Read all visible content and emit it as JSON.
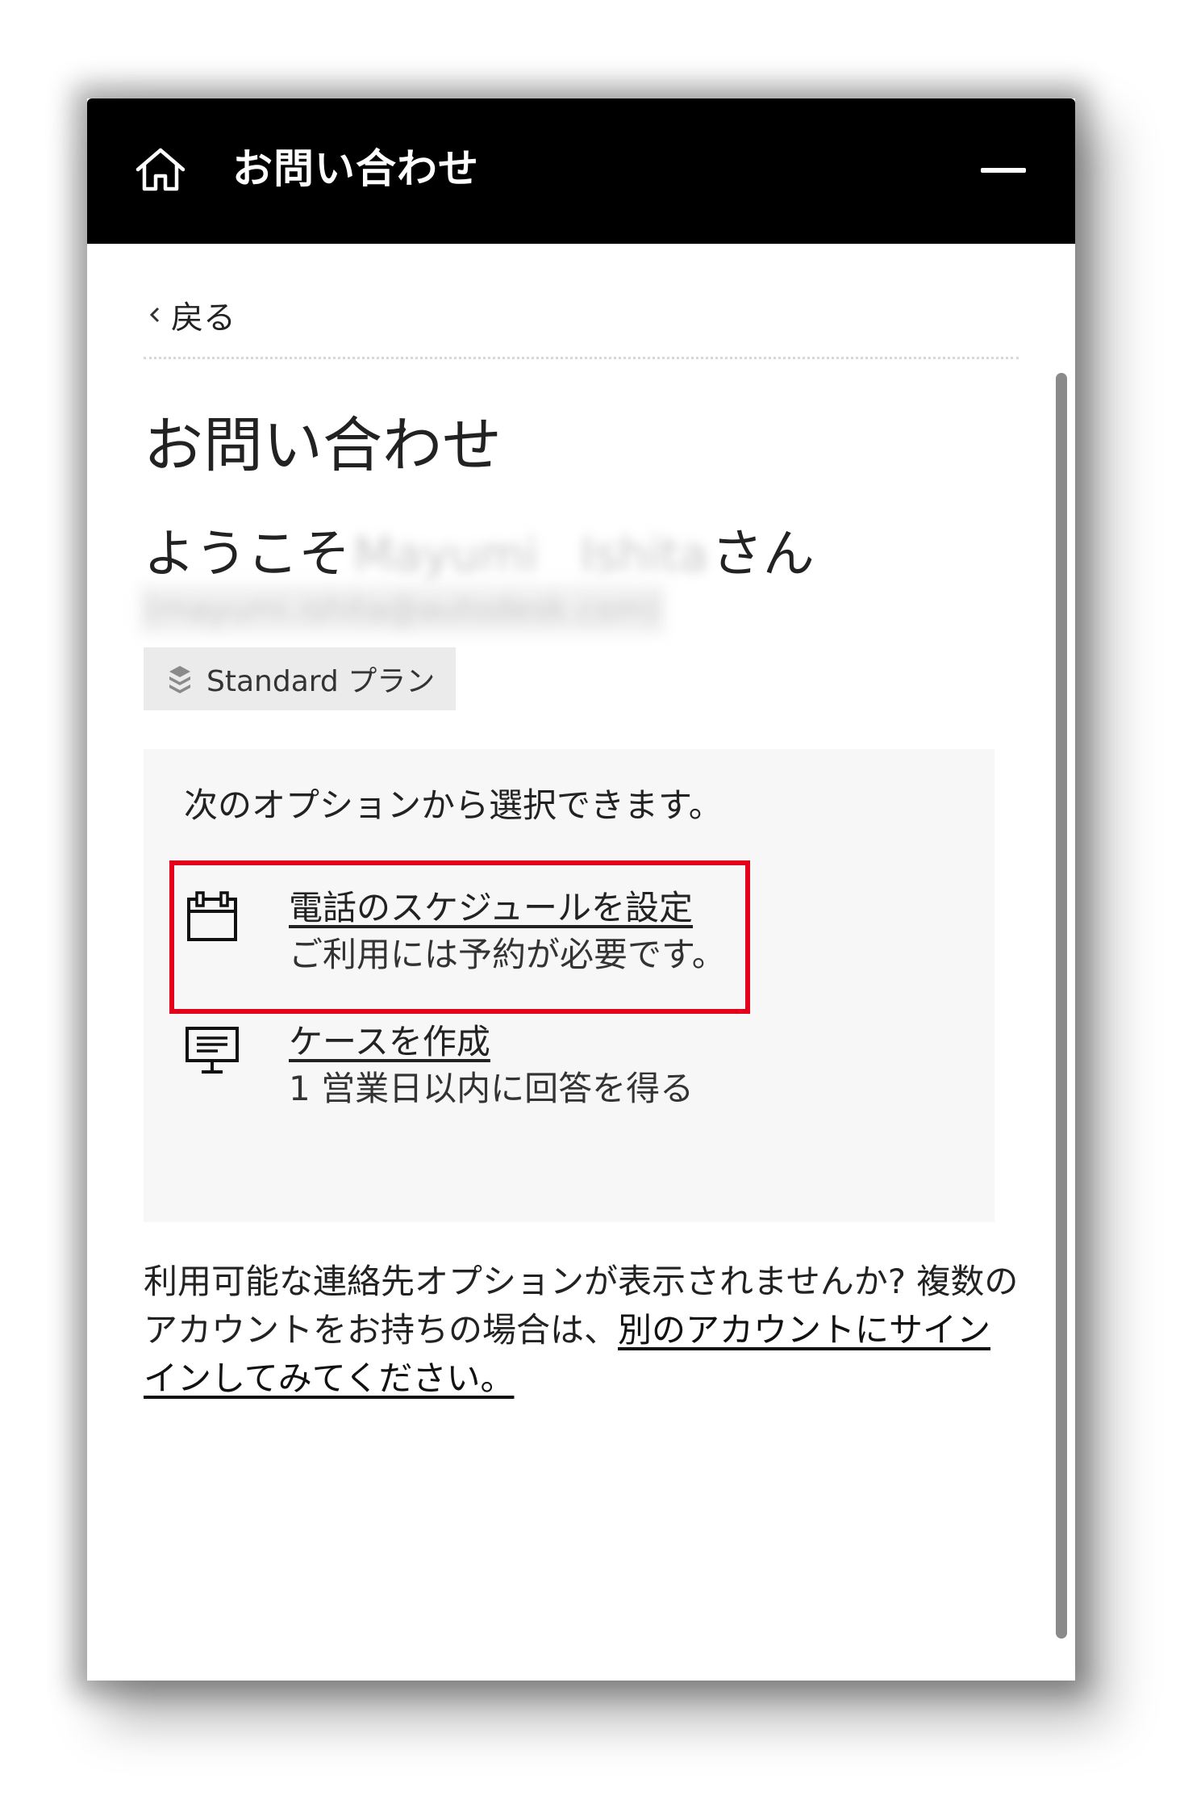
{
  "header": {
    "title": "お問い合わせ",
    "home_icon": "home-icon",
    "minimize_icon": "minimize-icon"
  },
  "nav": {
    "back_label": "戻る"
  },
  "page": {
    "title": "お問い合わせ",
    "welcome_prefix": "ようこそ",
    "first_name": "Mayumi",
    "last_name": "Ishita",
    "welcome_suffix": "さん",
    "email": "(mayumi.ishita@autodesk.com)",
    "plan_label": "Standard プラン",
    "plan_icon": "layers-icon"
  },
  "options": {
    "intro": "次のオプションから選択できます。",
    "items": [
      {
        "icon": "calendar-icon",
        "link": "電話のスケジュールを設定",
        "sub": "ご利用には予約が必要です。"
      },
      {
        "icon": "monitor-icon",
        "link": "ケースを作成",
        "sub": "1 営業日以内に回答を得る"
      }
    ]
  },
  "footer": {
    "text": "利用可能な連絡先オプションが表示されませんか? 複数のアカウントをお持ちの場合は、",
    "link": "別のアカウントにサインインしてみてください。"
  },
  "colors": {
    "header_bg": "#000000",
    "highlight": "#e2001a",
    "options_bg": "#f7f7f7",
    "badge_bg": "#ebebeb"
  }
}
